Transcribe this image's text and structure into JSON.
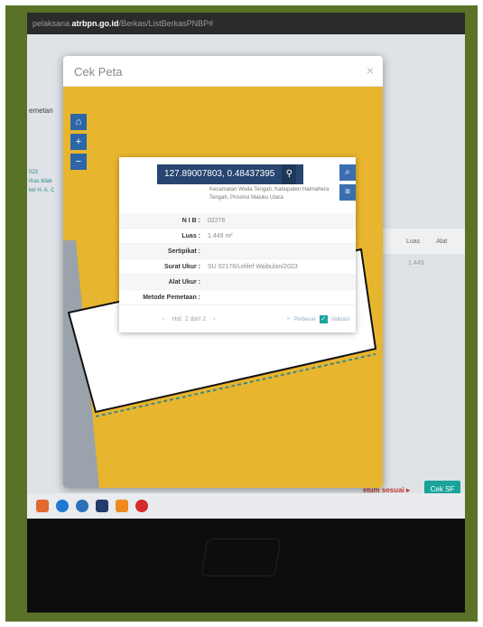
{
  "browser": {
    "url_prefix": "pelaksana.",
    "url_host": "atrbpn.go.id",
    "url_path": "/Berkas/ListBerkasPNBP#"
  },
  "page": {
    "left_heading": "emetan",
    "side_labels": [
      "023",
      "rhas tidak",
      "kel H. A. C"
    ],
    "table_headers": [
      "Luas",
      "Alat"
    ],
    "table_value": "1.449",
    "status_text": "elum sesuai ▸",
    "cek_button": "Cek SF"
  },
  "modal": {
    "title": "Cek Peta",
    "close": "×"
  },
  "map": {
    "controls": [
      "⌂",
      "+",
      "−"
    ],
    "colors": {
      "parcel_fill": "#e8b52e",
      "selected_fill": "#ffffff",
      "road": "#9aa3ab"
    }
  },
  "popup": {
    "coordinates": "127.89007803, 0.48437395",
    "address": "Kecamatan Weda Tengah, Kabupaten Halmahera Tengah, Provinsi Maluku Utara",
    "rows": [
      {
        "label": "N I B :",
        "value": "02276"
      },
      {
        "label": "Luas :",
        "value": "1.449 m²"
      },
      {
        "label": "Sertipikat :",
        "value": ""
      },
      {
        "label": "Surat Ukur :",
        "value": "SU 02176/Lelilef Waibulan/2023"
      },
      {
        "label": "Alat Ukur :",
        "value": ""
      },
      {
        "label": "Metode Pemetaan :",
        "value": ""
      }
    ],
    "pager": {
      "prev": "‹",
      "label": "Hal. 2 dari 2",
      "next": "›"
    },
    "search_option": "Perbesar",
    "check_option": "Validasi"
  }
}
